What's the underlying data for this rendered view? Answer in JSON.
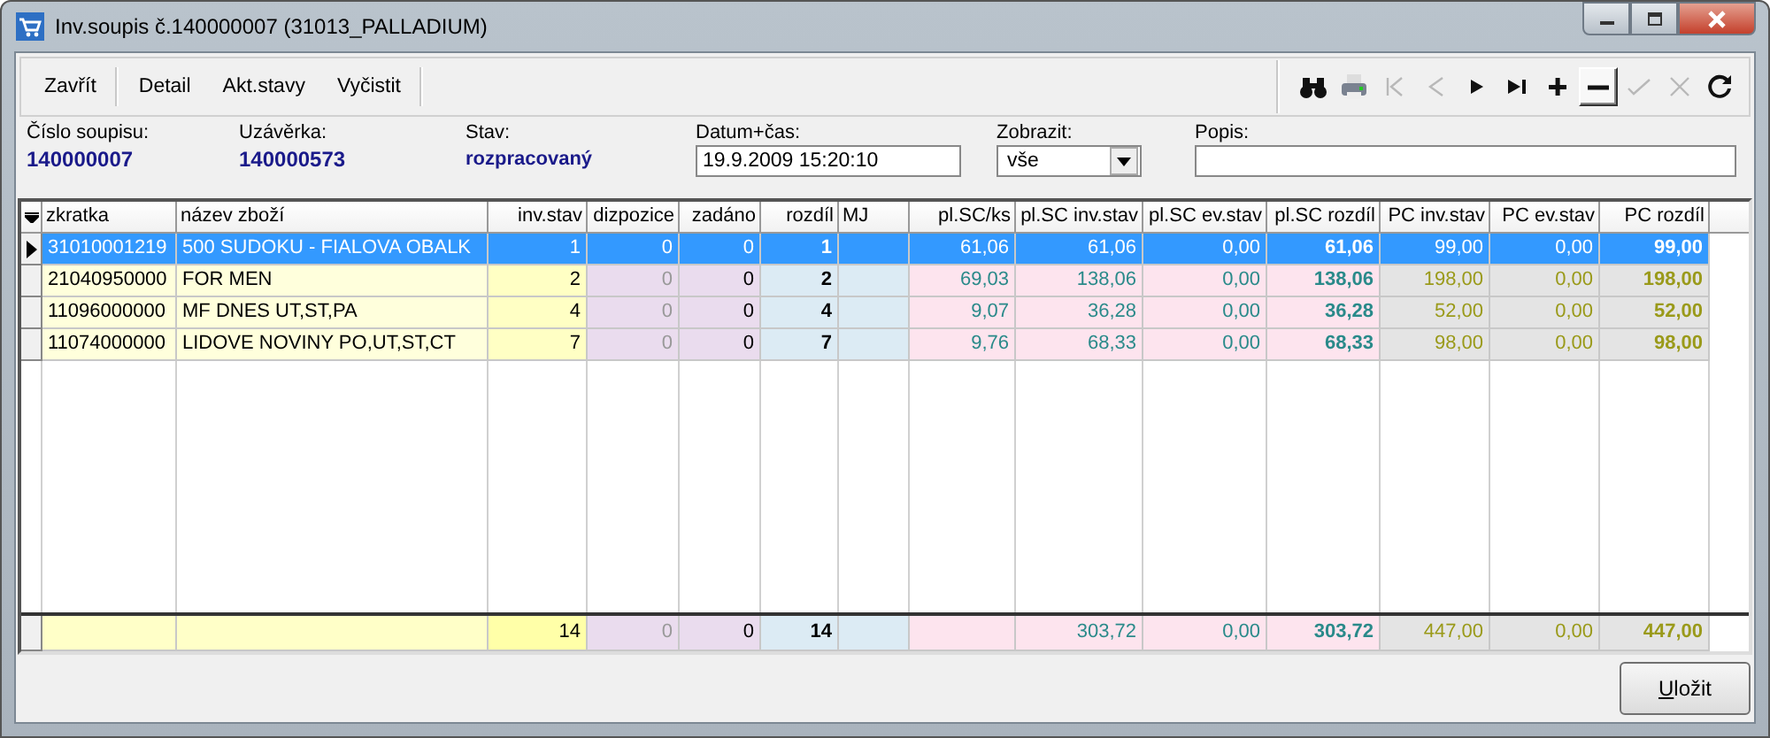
{
  "window": {
    "title": "Inv.soupis č.140000007 (31013_PALLADIUM)"
  },
  "toolbar": {
    "groups": [
      [
        "Zavřít"
      ],
      [
        "Detail",
        "Akt.stavy",
        "Vyčistit"
      ]
    ],
    "tools": [
      {
        "kind": "find",
        "disabled": false,
        "pressed": false
      },
      {
        "kind": "print",
        "disabled": false,
        "pressed": false
      },
      {
        "kind": "first",
        "disabled": true,
        "pressed": false
      },
      {
        "kind": "prev",
        "disabled": true,
        "pressed": false
      },
      {
        "kind": "next",
        "disabled": false,
        "pressed": false
      },
      {
        "kind": "last",
        "disabled": false,
        "pressed": false
      },
      {
        "kind": "add",
        "disabled": false,
        "pressed": false
      },
      {
        "kind": "remove",
        "disabled": false,
        "pressed": true
      },
      {
        "kind": "confirm",
        "disabled": true,
        "pressed": false
      },
      {
        "kind": "cancel",
        "disabled": true,
        "pressed": false
      },
      {
        "kind": "refresh",
        "disabled": false,
        "pressed": false
      }
    ]
  },
  "header": {
    "info": [
      {
        "label": "Číslo soupisu:",
        "value": "140000007"
      },
      {
        "label": "Uzávěrka:",
        "value": "140000573"
      },
      {
        "label": "Stav:",
        "value": "rozpracovaný"
      }
    ],
    "datetime": {
      "label": "Datum+čas:",
      "value": "19.9.2009 15:20:10"
    },
    "show": {
      "label": "Zobrazit:",
      "value": "vše"
    },
    "description": {
      "label": "Popis:"
    }
  },
  "table": {
    "columns": [
      {
        "label": "zkratka",
        "kind": "name"
      },
      {
        "label": "název zboží",
        "kind": "name"
      },
      {
        "label": "inv.stav",
        "kind": "inv"
      },
      {
        "label": "dizpozice",
        "kind": "disp"
      },
      {
        "label": "zadáno",
        "kind": "zad"
      },
      {
        "label": "rozdíl",
        "kind": "diff"
      },
      {
        "label": "MJ",
        "kind": "mj"
      },
      {
        "label": "pl.SC/ks",
        "kind": "plsc"
      },
      {
        "label": "pl.SC inv.stav",
        "kind": "plsc"
      },
      {
        "label": "pl.SC ev.stav",
        "kind": "plsc"
      },
      {
        "label": "pl.SC rozdíl",
        "kind": "plsc_diff"
      },
      {
        "label": "PC inv.stav",
        "kind": "pc"
      },
      {
        "label": "PC ev.stav",
        "kind": "pc"
      },
      {
        "label": "PC rozdíl",
        "kind": "pc_diff"
      }
    ],
    "rows": [
      {
        "selected": true,
        "cells": [
          "31010001219",
          "500 SUDOKU - FIALOVA OBALK",
          "1",
          "0",
          "0",
          "1",
          null,
          "61,06",
          "61,06",
          "0,00",
          "61,06",
          "99,00",
          "0,00",
          "99,00"
        ]
      },
      {
        "selected": false,
        "cells": [
          "21040950000",
          "FOR MEN",
          "2",
          "0",
          "0",
          "2",
          null,
          "69,03",
          "138,06",
          "0,00",
          "138,06",
          "198,00",
          "0,00",
          "198,00"
        ]
      },
      {
        "selected": false,
        "cells": [
          "11096000000",
          "MF DNES UT,ST,PA",
          "4",
          "0",
          "0",
          "4",
          null,
          "9,07",
          "36,28",
          "0,00",
          "36,28",
          "52,00",
          "0,00",
          "52,00"
        ]
      },
      {
        "selected": false,
        "cells": [
          "11074000000",
          "LIDOVE NOVINY PO,UT,ST,CT",
          "7",
          "0",
          "0",
          "7",
          null,
          "9,76",
          "68,33",
          "0,00",
          "68,33",
          "98,00",
          "0,00",
          "98,00"
        ]
      }
    ],
    "totals": {
      "cells": [
        null,
        null,
        "14",
        "0",
        "0",
        "14",
        null,
        null,
        "303,72",
        "0,00",
        "303,72",
        "447,00",
        "0,00",
        "447,00"
      ]
    }
  },
  "footer": {
    "save_button": "Uložit"
  }
}
